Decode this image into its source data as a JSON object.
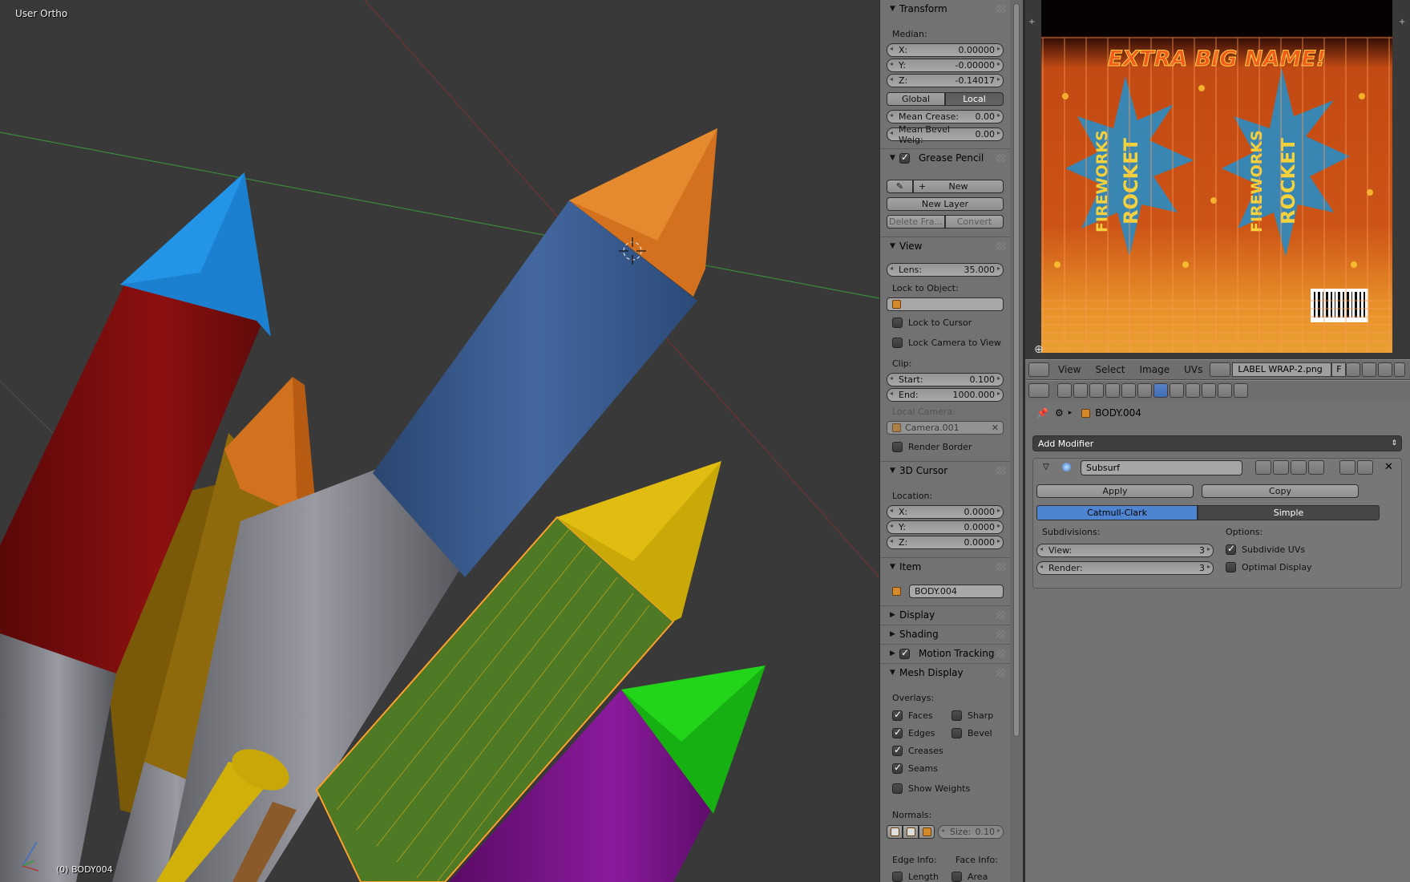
{
  "viewport": {
    "view_label": "User Ortho",
    "object_label": "(0) BODY004"
  },
  "npanel": {
    "transform": {
      "title": "Transform",
      "median_label": "Median:",
      "x": {
        "label": "X:",
        "value": "0.00000"
      },
      "y": {
        "label": "Y:",
        "value": "-0.00000"
      },
      "z": {
        "label": "Z:",
        "value": "-0.14017"
      },
      "global": "Global",
      "local": "Local",
      "mean_crease": {
        "label": "Mean Crease:",
        "value": "0.00"
      },
      "mean_bevel": {
        "label": "Mean Bevel Weig:",
        "value": "0.00"
      }
    },
    "grease_pencil": {
      "title": "Grease Pencil",
      "new": "New",
      "new_layer": "New Layer",
      "delete_frame": "Delete Fra...",
      "convert": "Convert"
    },
    "view": {
      "title": "View",
      "lens": {
        "label": "Lens:",
        "value": "35.000"
      },
      "lock_to_object": "Lock to Object:",
      "lock_to_cursor": "Lock to Cursor",
      "lock_camera": "Lock Camera to View",
      "clip_label": "Clip:",
      "start": {
        "label": "Start:",
        "value": "0.100"
      },
      "end": {
        "label": "End:",
        "value": "1000.000"
      },
      "local_camera": "Local Camera:",
      "camera": "Camera.001",
      "render_border": "Render Border"
    },
    "cursor": {
      "title": "3D Cursor",
      "location_label": "Location:",
      "x": {
        "label": "X:",
        "value": "0.0000"
      },
      "y": {
        "label": "Y:",
        "value": "0.0000"
      },
      "z": {
        "label": "Z:",
        "value": "0.0000"
      }
    },
    "item": {
      "title": "Item",
      "name": "BODY.004"
    },
    "display_title": "Display",
    "shading_title": "Shading",
    "motion_tracking_title": "Motion Tracking",
    "mesh_display": {
      "title": "Mesh Display",
      "overlays_label": "Overlays:",
      "faces": "Faces",
      "sharp": "Sharp",
      "edges": "Edges",
      "bevel": "Bevel",
      "creases": "Creases",
      "seams": "Seams",
      "show_weights": "Show Weights",
      "normals_label": "Normals:",
      "size": {
        "label": "Size:",
        "value": "0.10"
      },
      "edge_info": "Edge Info:",
      "face_info": "Face Info:",
      "length": "Length",
      "area": "Area"
    }
  },
  "image_editor": {
    "texture_title_top": "EXTRA BIG NAME!",
    "texture_text_a": "FIREWORKS",
    "texture_text_b": "ROCKET",
    "menus": [
      "View",
      "Select",
      "Image",
      "UVs"
    ],
    "image_name": "LABEL WRAP-2.png",
    "fake_user": "F"
  },
  "properties": {
    "object_name": "BODY.004",
    "add_modifier": "Add Modifier",
    "modifier_name": "Subsurf",
    "apply": "Apply",
    "copy": "Copy",
    "catmull_clark": "Catmull-Clark",
    "simple": "Simple",
    "subdivisions_label": "Subdivisions:",
    "options_label": "Options:",
    "view": {
      "label": "View:",
      "value": "3"
    },
    "render": {
      "label": "Render:",
      "value": "3"
    },
    "subdivide_uvs": "Subdivide UVs",
    "optimal_display": "Optimal Display"
  }
}
